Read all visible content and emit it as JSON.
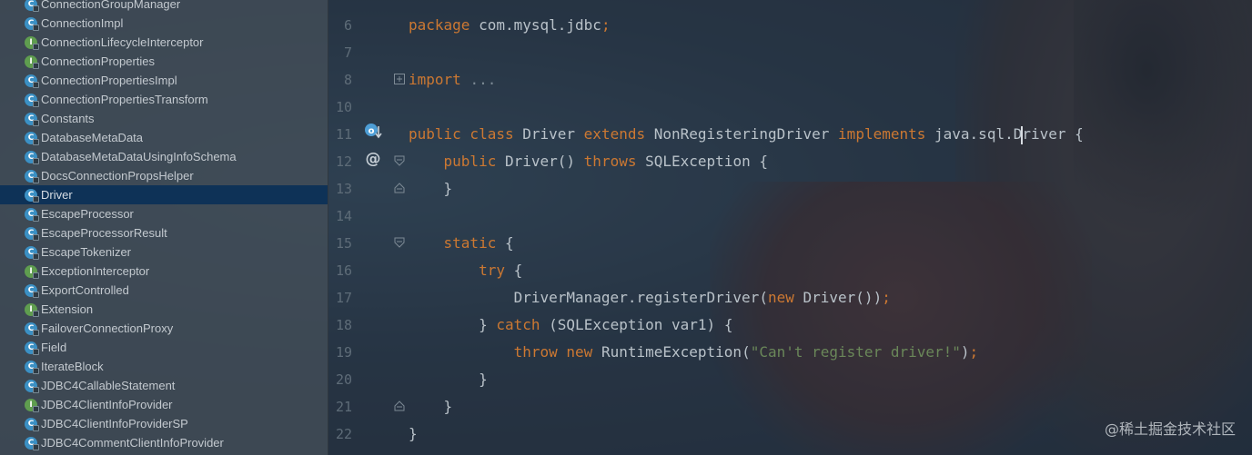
{
  "colors": {
    "keyword": "#cc7832",
    "string": "#6a8759",
    "selection": "#0e3257",
    "class_icon": "#3b90c4",
    "interface_icon": "#5f9d4f"
  },
  "sidebar": {
    "items": [
      {
        "label": "ConnectionGroupManager",
        "icon": "class-icon"
      },
      {
        "label": "ConnectionImpl",
        "icon": "class-icon"
      },
      {
        "label": "ConnectionLifecycleInterceptor",
        "icon": "interface-icon"
      },
      {
        "label": "ConnectionProperties",
        "icon": "interface-icon"
      },
      {
        "label": "ConnectionPropertiesImpl",
        "icon": "class-icon"
      },
      {
        "label": "ConnectionPropertiesTransform",
        "icon": "class-icon"
      },
      {
        "label": "Constants",
        "icon": "class-icon"
      },
      {
        "label": "DatabaseMetaData",
        "icon": "class-icon"
      },
      {
        "label": "DatabaseMetaDataUsingInfoSchema",
        "icon": "class-icon"
      },
      {
        "label": "DocsConnectionPropsHelper",
        "icon": "class-icon"
      },
      {
        "label": "Driver",
        "icon": "class-icon",
        "selected": true
      },
      {
        "label": "EscapeProcessor",
        "icon": "class-icon"
      },
      {
        "label": "EscapeProcessorResult",
        "icon": "class-icon"
      },
      {
        "label": "EscapeTokenizer",
        "icon": "class-icon"
      },
      {
        "label": "ExceptionInterceptor",
        "icon": "interface-icon"
      },
      {
        "label": "ExportControlled",
        "icon": "class-icon"
      },
      {
        "label": "Extension",
        "icon": "interface-icon"
      },
      {
        "label": "FailoverConnectionProxy",
        "icon": "class-icon"
      },
      {
        "label": "Field",
        "icon": "class-icon"
      },
      {
        "label": "IterateBlock",
        "icon": "class-icon"
      },
      {
        "label": "JDBC4CallableStatement",
        "icon": "class-icon"
      },
      {
        "label": "JDBC4ClientInfoProvider",
        "icon": "interface-icon"
      },
      {
        "label": "JDBC4ClientInfoProviderSP",
        "icon": "class-icon"
      },
      {
        "label": "JDBC4CommentClientInfoProvider",
        "icon": "class-icon"
      }
    ]
  },
  "editor": {
    "lines": [
      {
        "num": "6",
        "text": "package com.mysql.jdbc;"
      },
      {
        "num": "7",
        "text": ""
      },
      {
        "num": "8",
        "text": "import ..."
      },
      {
        "num": "10",
        "text": ""
      },
      {
        "num": "11",
        "text": "public class Driver extends NonRegisteringDriver implements java.sql.Driver {"
      },
      {
        "num": "12",
        "text": "    public Driver() throws SQLException {"
      },
      {
        "num": "13",
        "text": "    }"
      },
      {
        "num": "14",
        "text": ""
      },
      {
        "num": "15",
        "text": "    static {"
      },
      {
        "num": "16",
        "text": "        try {"
      },
      {
        "num": "17",
        "text": "            DriverManager.registerDriver(new Driver());"
      },
      {
        "num": "18",
        "text": "        } catch (SQLException var1) {"
      },
      {
        "num": "19",
        "text": "            throw new RuntimeException(\"Can't register driver!\");"
      },
      {
        "num": "20",
        "text": "        }"
      },
      {
        "num": "21",
        "text": "    }"
      },
      {
        "num": "22",
        "text": "}"
      }
    ],
    "gutter_icons": {
      "line11": "implements-override-icon",
      "line12": "annotation-at-icon"
    }
  },
  "watermark": "@稀土掘金技术社区"
}
